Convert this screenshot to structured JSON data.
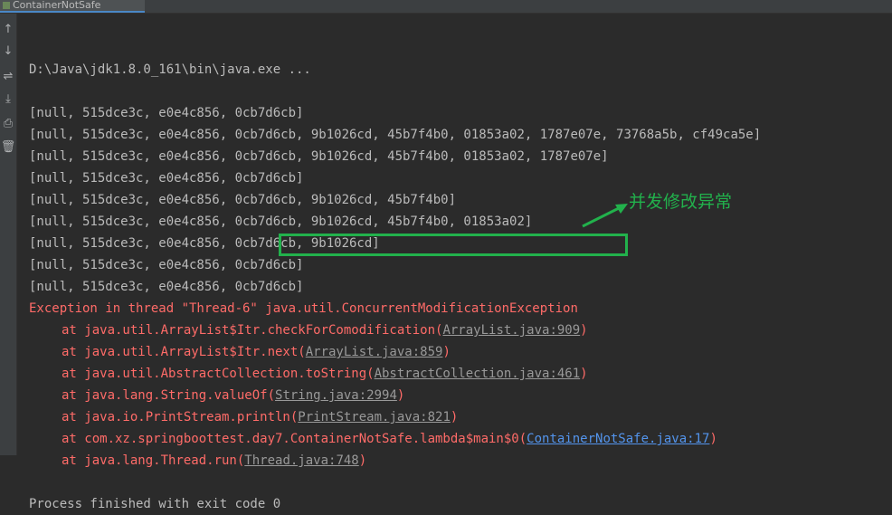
{
  "tab": {
    "title": "ContainerNotSafe"
  },
  "toolbar": [
    {
      "name": "up-arrow-icon",
      "glyph": "↑"
    },
    {
      "name": "down-arrow-icon",
      "glyph": "↓"
    },
    {
      "name": "soft-wrap-icon",
      "glyph": "⇌"
    },
    {
      "name": "scroll-to-end-icon",
      "glyph": "⤓"
    },
    {
      "name": "print-icon",
      "glyph": "⎙"
    },
    {
      "name": "trash-icon",
      "glyph": "🗑"
    }
  ],
  "console": {
    "command": "D:\\Java\\jdk1.8.0_161\\bin\\java.exe ...",
    "output": [
      "[null, 515dce3c, e0e4c856, 0cb7d6cb]",
      "[null, 515dce3c, e0e4c856, 0cb7d6cb, 9b1026cd, 45b7f4b0, 01853a02, 1787e07e, 73768a5b, cf49ca5e]",
      "[null, 515dce3c, e0e4c856, 0cb7d6cb, 9b1026cd, 45b7f4b0, 01853a02, 1787e07e]",
      "[null, 515dce3c, e0e4c856, 0cb7d6cb]",
      "[null, 515dce3c, e0e4c856, 0cb7d6cb, 9b1026cd, 45b7f4b0]",
      "[null, 515dce3c, e0e4c856, 0cb7d6cb, 9b1026cd, 45b7f4b0, 01853a02]",
      "[null, 515dce3c, e0e4c856, 0cb7d6cb, 9b1026cd]",
      "[null, 515dce3c, e0e4c856, 0cb7d6cb]",
      "[null, 515dce3c, e0e4c856, 0cb7d6cb]"
    ],
    "exception": {
      "prefix": "Exception in thread \"Thread-6\" ",
      "name": "java.util.ConcurrentModificationException"
    },
    "stack": [
      {
        "text": "at java.util.ArrayList$Itr.checkForComodification(",
        "link": "ArrayList.java:909",
        "blue": false
      },
      {
        "text": "at java.util.ArrayList$Itr.next(",
        "link": "ArrayList.java:859",
        "blue": false
      },
      {
        "text": "at java.util.AbstractCollection.toString(",
        "link": "AbstractCollection.java:461",
        "blue": false
      },
      {
        "text": "at java.lang.String.valueOf(",
        "link": "String.java:2994",
        "blue": false
      },
      {
        "text": "at java.io.PrintStream.println(",
        "link": "PrintStream.java:821",
        "blue": false
      },
      {
        "text": "at com.xz.springboottest.day7.ContainerNotSafe.lambda$main$0(",
        "link": "ContainerNotSafe.java:17",
        "blue": true
      },
      {
        "text": "at java.lang.Thread.run(",
        "link": "Thread.java:748",
        "blue": false
      }
    ],
    "exit": "Process finished with exit code 0"
  },
  "annotation": {
    "text": "并发修改异常",
    "color": "#22b14c"
  }
}
